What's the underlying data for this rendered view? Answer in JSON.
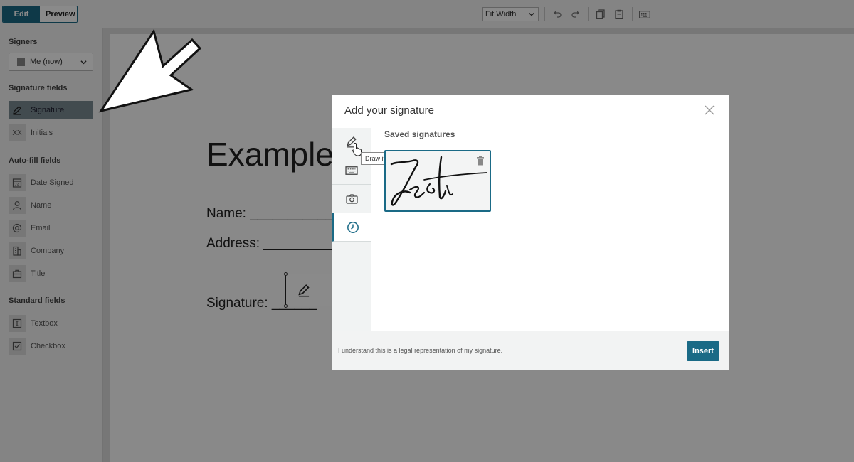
{
  "toolbar": {
    "edit_label": "Edit",
    "preview_label": "Preview",
    "zoom_value": "Fit Width"
  },
  "sidebar": {
    "signers_heading": "Signers",
    "signer_selected": "Me (now)",
    "signature_fields_heading": "Signature fields",
    "signature_label": "Signature",
    "initials_label": "Initials",
    "initials_icon_text": "XX",
    "autofill_heading": "Auto-fill fields",
    "date_signed_label": "Date Signed",
    "name_label": "Name",
    "email_label": "Email",
    "company_label": "Company",
    "title_label": "Title",
    "standard_heading": "Standard fields",
    "textbox_label": "Textbox",
    "checkbox_label": "Checkbox"
  },
  "document": {
    "title": "Example",
    "name_line": "Name: ____________",
    "address_line": "Address: __________",
    "signature_line": "Signature: ______"
  },
  "modal": {
    "title": "Add your signature",
    "tooltip": "Draw it in",
    "saved_heading": "Saved signatures",
    "legal_text": "I understand this is a legal representation of my signature.",
    "insert_label": "Insert"
  },
  "colors": {
    "accent": "#1a6a86",
    "overlay": "rgba(0,0,0,0.46)"
  },
  "icons": [
    "pencil-icon",
    "keyboard-icon",
    "camera-icon",
    "clock-icon",
    "close-icon",
    "trash-icon",
    "undo-icon",
    "redo-icon",
    "copy-icon",
    "clipboard-icon",
    "keyboard-icon",
    "chevron-down-icon"
  ]
}
